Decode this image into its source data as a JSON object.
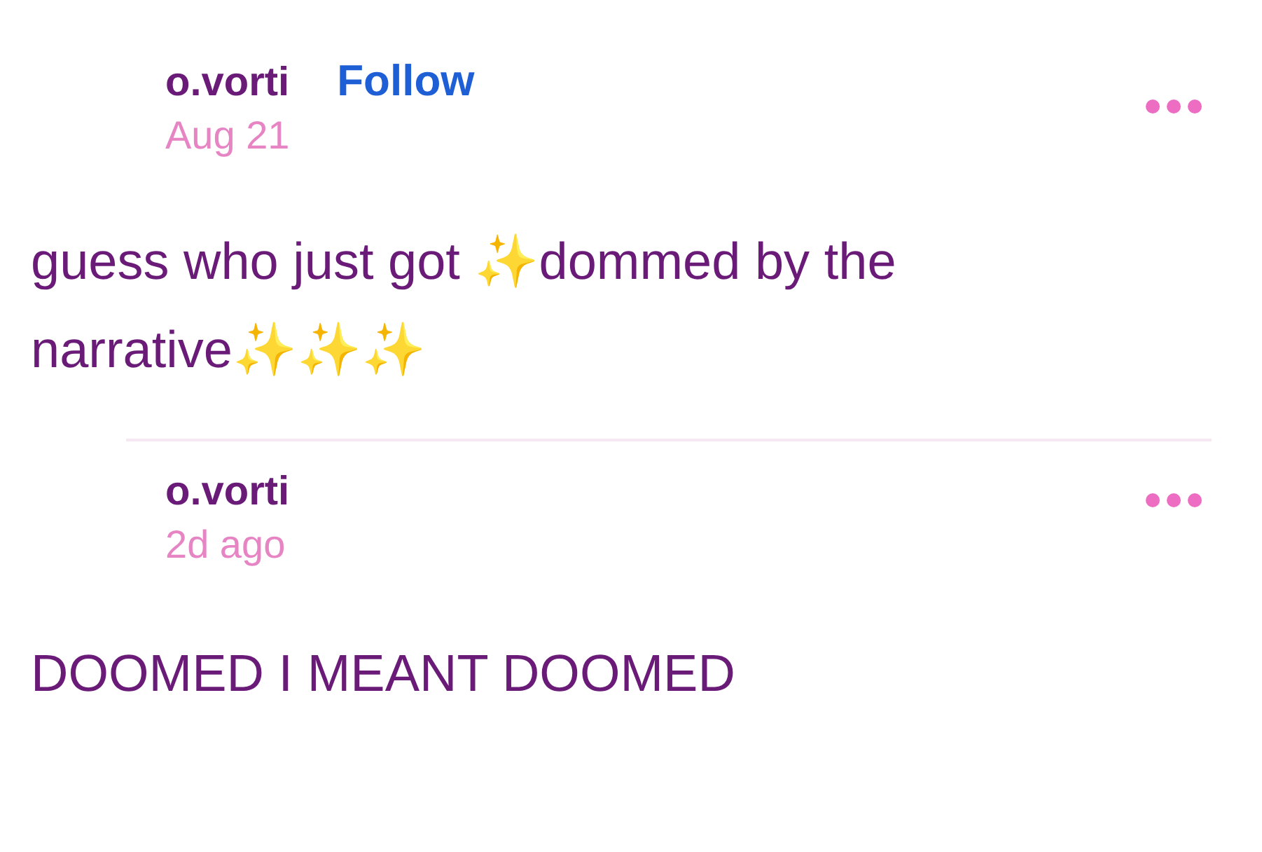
{
  "posts": [
    {
      "author": "o.vorti",
      "follow": "Follow",
      "date": "Aug 21",
      "body": "guess who just got ✨dommed by the narrative✨✨✨"
    },
    {
      "author": "o.vorti",
      "date": "2d ago",
      "body": "DOOMED I MEANT DOOMED"
    }
  ]
}
